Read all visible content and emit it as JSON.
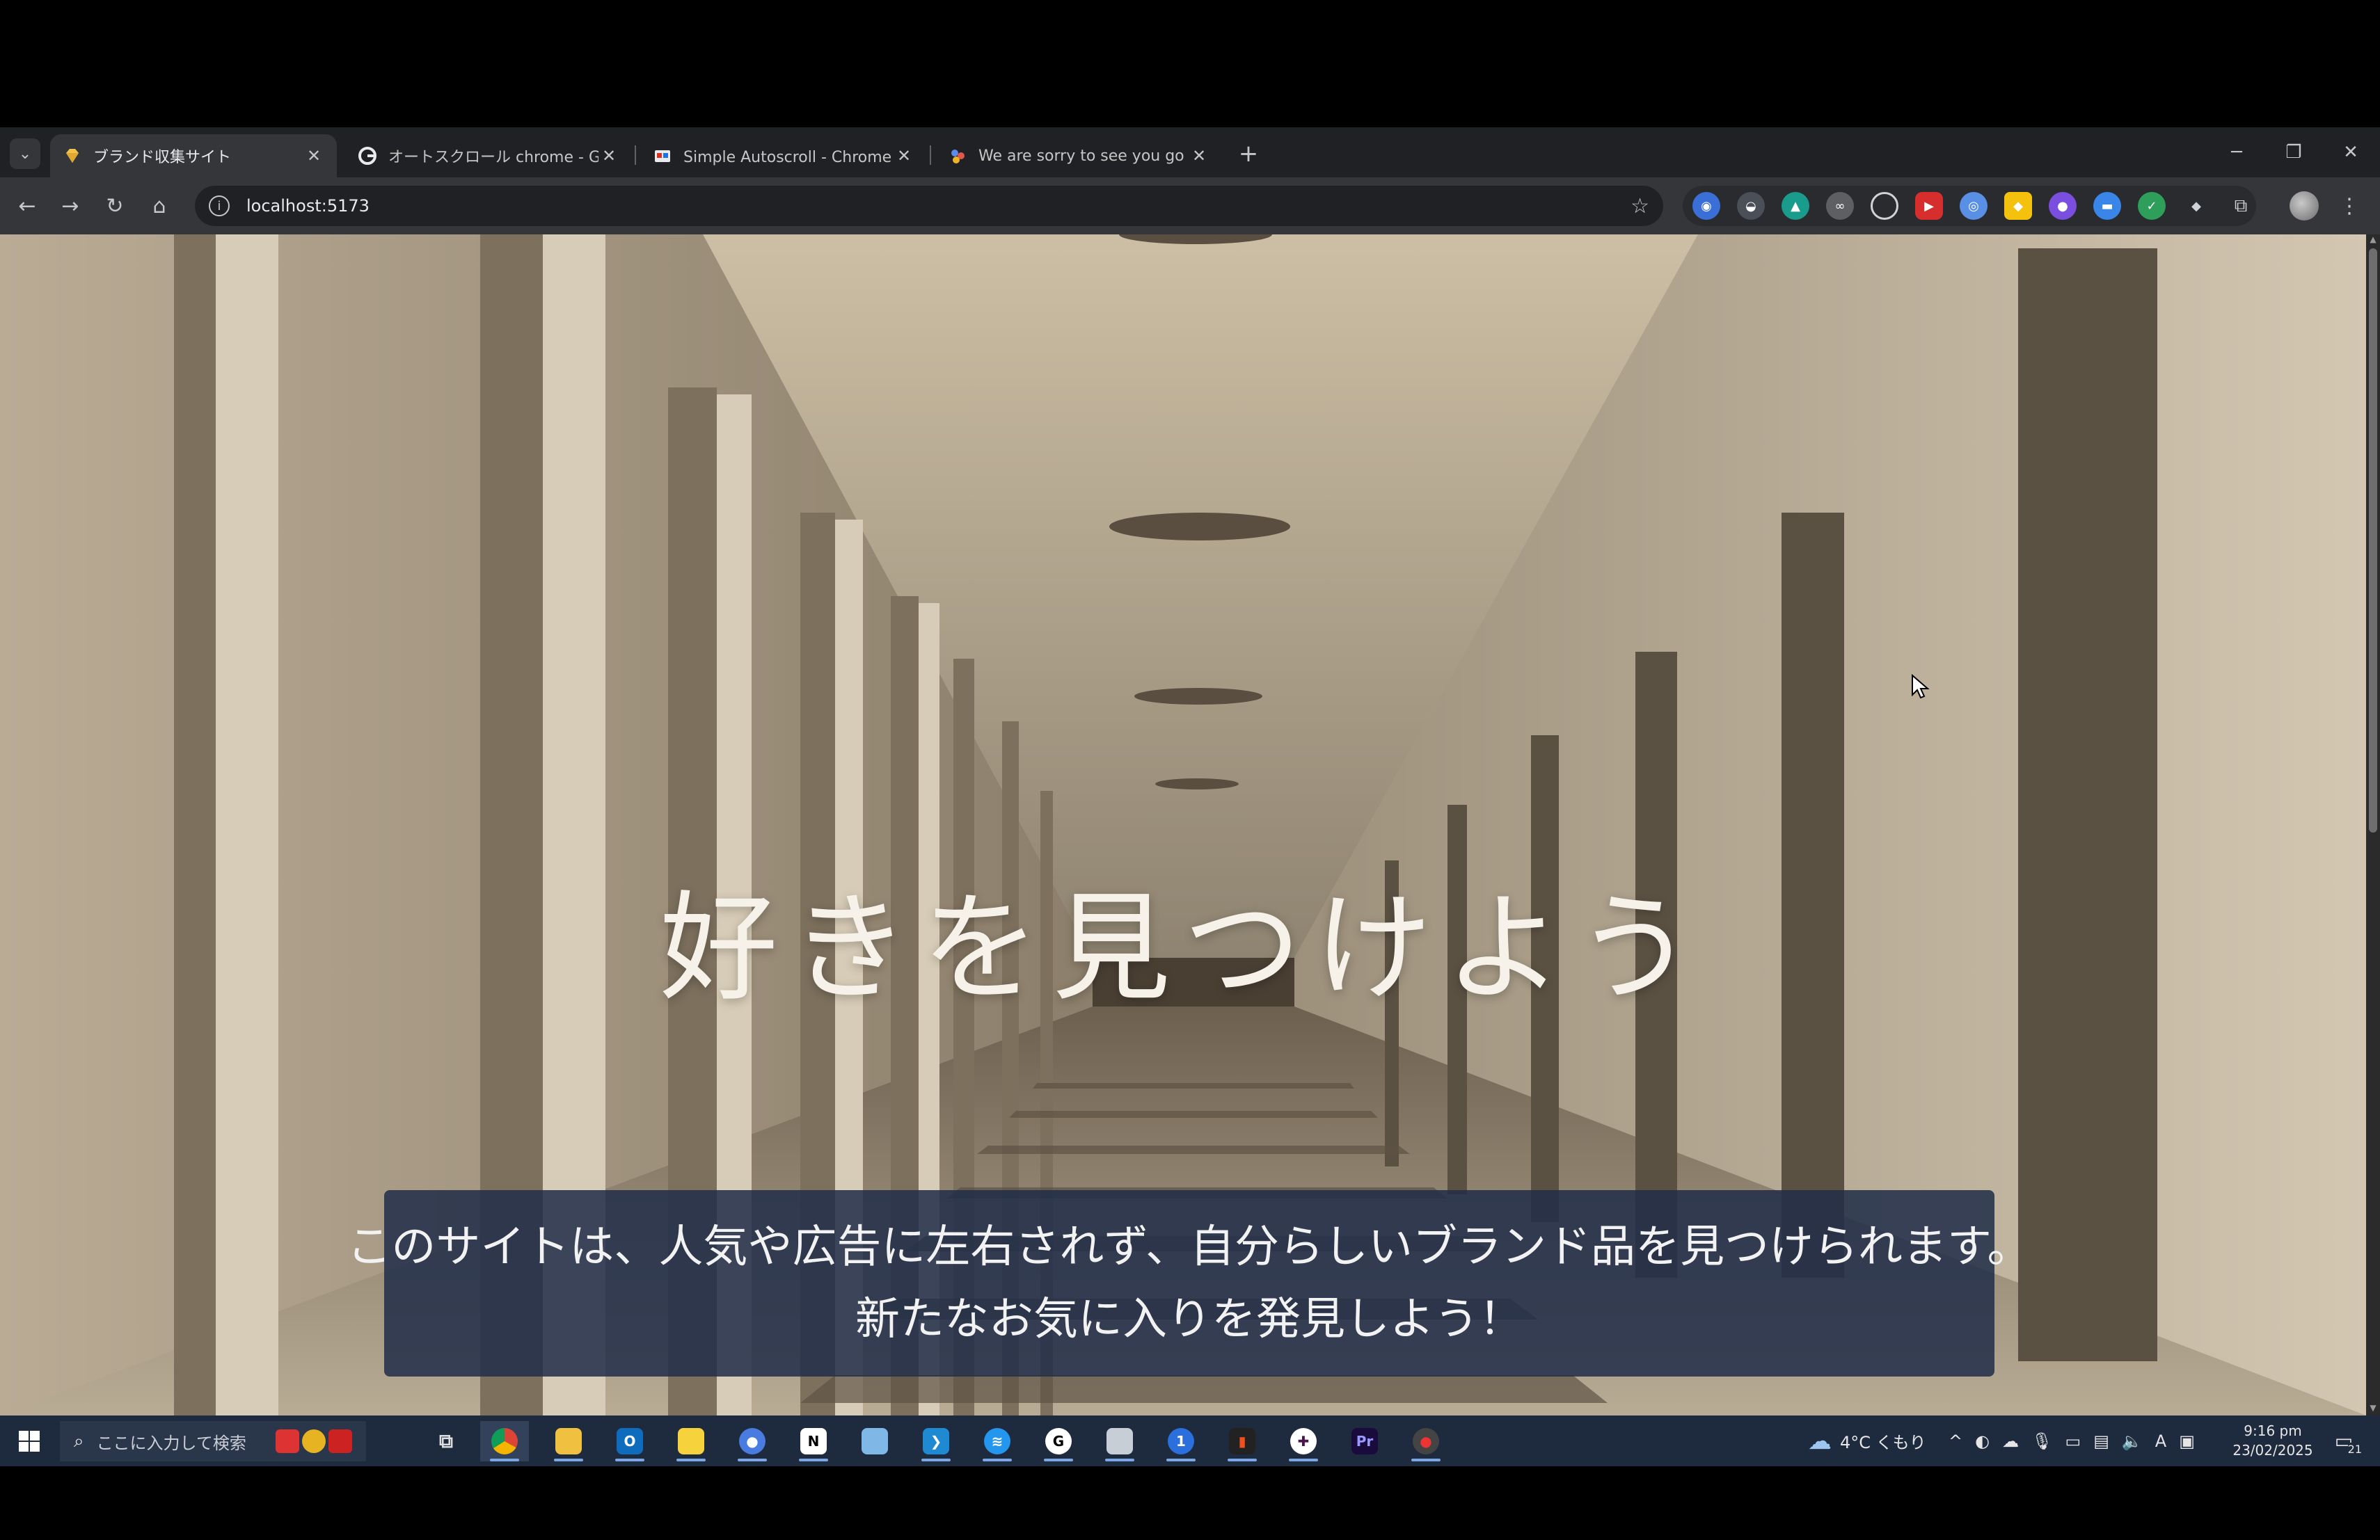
{
  "browser": {
    "tabs": [
      {
        "title": "ブランド収集サイト",
        "active": true,
        "favicon": "gem-icon"
      },
      {
        "title": "オートスクロール chrome - Google",
        "active": false,
        "favicon": "google-icon"
      },
      {
        "title": "Simple Autoscroll - Chrome ウェ",
        "active": false,
        "favicon": "webstore-icon"
      },
      {
        "title": "We are sorry to see you go - Fu",
        "active": false,
        "favicon": "people-icon"
      }
    ],
    "new_tab_glyph": "+",
    "url": "localhost:5173"
  },
  "page": {
    "hero_title": "好きを見つけよう",
    "hero_text_line1": "このサイトは、人気や広告に左右されず、自分らしいブランド品を見つけられます。",
    "hero_text_line2": "新たなお気に入りを発見しよう！"
  },
  "taskbar": {
    "search_placeholder": "ここに入力して検索",
    "weather": "4°C くもり",
    "ime_indicator": "A",
    "time": "9:16 pm",
    "date": "23/02/2025",
    "notification_count": "21"
  },
  "colors": {
    "tab_strip": "#202124",
    "toolbar": "#35363a",
    "hero_box": "#212d48",
    "taskbar": "#1e2a3d"
  }
}
